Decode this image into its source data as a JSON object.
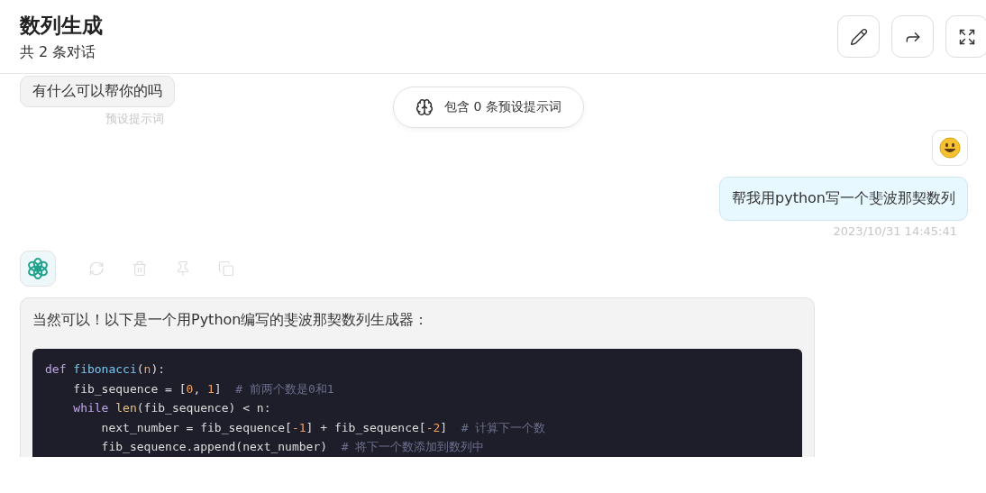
{
  "header": {
    "title": "数列生成",
    "subtitle": "共 2 条对话"
  },
  "header_buttons": [
    {
      "kind": "edit"
    },
    {
      "kind": "share"
    },
    {
      "kind": "fullscreen"
    }
  ],
  "preset_message": {
    "text": "有什么可以帮你的吗",
    "label": "预设提示词"
  },
  "prompt_badge": {
    "text": "包含 0 条预设提示词"
  },
  "user_message": {
    "text": "帮我用python写一个斐波那契数列",
    "time": "2023/10/31 14:45:41"
  },
  "bot_actions": [
    {
      "kind": "retry"
    },
    {
      "kind": "delete"
    },
    {
      "kind": "pin"
    },
    {
      "kind": "copy"
    }
  ],
  "bot_message": {
    "text": "当然可以！以下是一个用Python编写的斐波那契数列生成器：",
    "code_lines": [
      {
        "tokens": [
          {
            "kind": "keyword",
            "text": "def "
          },
          {
            "kind": "function",
            "text": "fibonacci"
          },
          {
            "kind": "plain",
            "text": "("
          },
          {
            "kind": "param",
            "text": "n"
          },
          {
            "kind": "plain",
            "text": "):"
          }
        ]
      },
      {
        "tokens": [
          {
            "kind": "plain",
            "text": "    fib_sequence = ["
          },
          {
            "kind": "number",
            "text": "0"
          },
          {
            "kind": "plain",
            "text": ", "
          },
          {
            "kind": "number",
            "text": "1"
          },
          {
            "kind": "plain",
            "text": "]  "
          },
          {
            "kind": "comment",
            "text": "# 前两个数是0和1"
          }
        ]
      },
      {
        "tokens": [
          {
            "kind": "keyword",
            "text": "    while "
          },
          {
            "kind": "builtin",
            "text": "len"
          },
          {
            "kind": "plain",
            "text": "(fib_sequence) < n:"
          }
        ]
      },
      {
        "tokens": [
          {
            "kind": "plain",
            "text": "        next_number = fib_sequence["
          },
          {
            "kind": "number",
            "text": "-1"
          },
          {
            "kind": "plain",
            "text": "] + fib_sequence["
          },
          {
            "kind": "number",
            "text": "-2"
          },
          {
            "kind": "plain",
            "text": "]  "
          },
          {
            "kind": "comment",
            "text": "# 计算下一个数"
          }
        ]
      },
      {
        "tokens": [
          {
            "kind": "plain",
            "text": "        fib_sequence.append(next_number)  "
          },
          {
            "kind": "comment",
            "text": "# 将下一个数添加到数列中"
          }
        ]
      }
    ]
  }
}
